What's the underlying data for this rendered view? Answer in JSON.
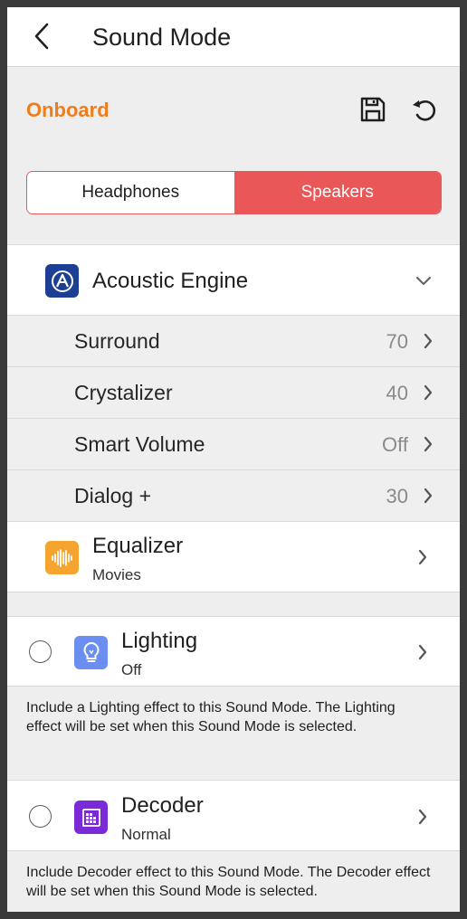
{
  "header": {
    "title": "Sound Mode",
    "back_icon": "chevron-left-icon"
  },
  "toolbar": {
    "mode_name": "Onboard",
    "save_icon": "floppy-disk-icon",
    "reset_icon": "undo-icon"
  },
  "colors": {
    "accent_orange": "#ee7d1c",
    "accent_red": "#ea5759",
    "acoustic_blue": "#1c3f94",
    "equalizer_orange": "#f4a42f",
    "lighting_blue": "#6a8ff0",
    "decoder_purple": "#7b2bd6"
  },
  "segment": {
    "options": [
      "Headphones",
      "Speakers"
    ],
    "selected": "Speakers"
  },
  "acoustic_engine": {
    "title": "Acoustic Engine",
    "icon": "acoustic-engine-icon",
    "items": [
      {
        "label": "Surround",
        "value": "70"
      },
      {
        "label": "Crystalizer",
        "value": "40"
      },
      {
        "label": "Smart Volume",
        "value": "Off"
      },
      {
        "label": "Dialog +",
        "value": "30"
      }
    ]
  },
  "equalizer": {
    "title": "Equalizer",
    "value": "Movies",
    "icon": "waveform-icon"
  },
  "lighting": {
    "title": "Lighting",
    "value": "Off",
    "icon": "lightbulb-icon",
    "description": "Include a Lighting effect to this Sound Mode. The Lighting effect will be set when this Sound Mode is selected."
  },
  "decoder": {
    "title": "Decoder",
    "value": "Normal",
    "icon": "decoder-icon",
    "description": "Include Decoder effect to this Sound Mode. The Decoder effect will be set when this Sound Mode is selected."
  }
}
